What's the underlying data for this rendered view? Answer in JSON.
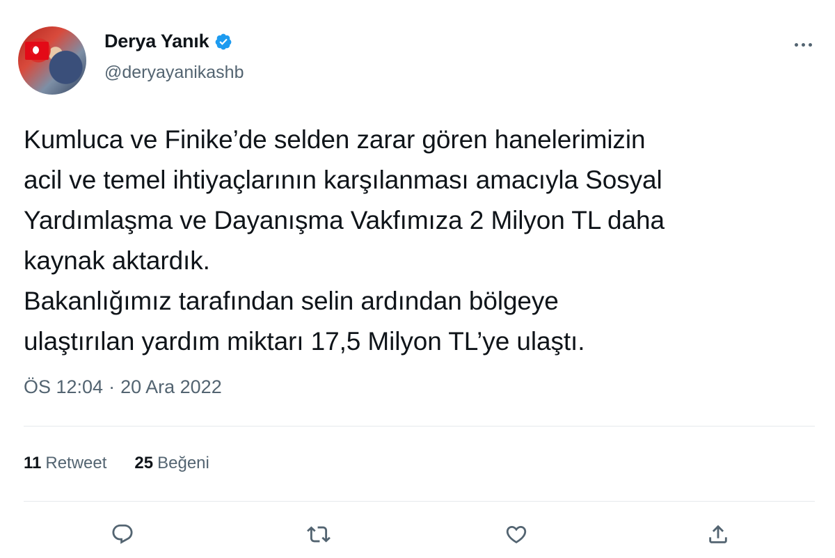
{
  "author": {
    "name": "Derya Yanık",
    "handle": "@deryayanikashb",
    "verified": true
  },
  "tweet": {
    "text": "Kumluca ve Finike’de selden zarar gören hanelerimizin\nacil ve temel ihtiyaçlarının karşılanması amacıyla Sosyal\nYardımlaşma ve Dayanışma Vakfımıza 2 Milyon TL daha\nkaynak aktardık.\nBakanlığımız tarafından selin ardından bölgeye\nulaştırılan yardım miktarı 17,5 Milyon TL’ye ulaştı.",
    "time": "ÖS 12:04",
    "separator": "·",
    "date": "20 Ara 2022"
  },
  "stats": {
    "retweets_count": "11",
    "retweets_label": "Retweet",
    "likes_count": "25",
    "likes_label": "Beğeni"
  },
  "icons": {
    "verified": "verified-badge-icon",
    "more": "more-options-icon",
    "reply": "reply-icon",
    "retweet": "retweet-icon",
    "like": "heart-icon",
    "share": "share-icon"
  },
  "colors": {
    "text": "#0f1419",
    "secondary": "#536471",
    "verified": "#1d9bf0",
    "divider": "#e5e9ec"
  }
}
